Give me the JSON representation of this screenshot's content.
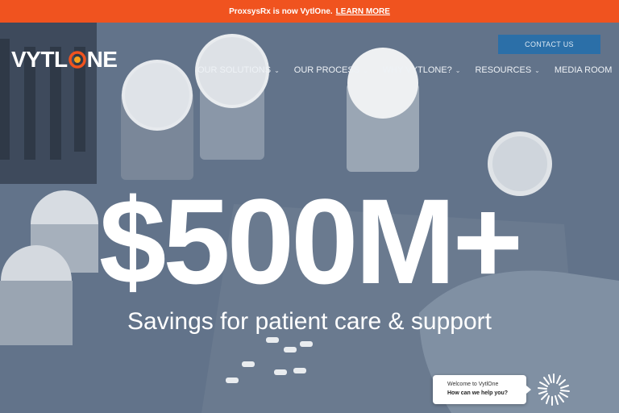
{
  "announcement": {
    "text": "ProxsysRx is now VytlOne.",
    "link": "LEARN MORE"
  },
  "logo": {
    "left": "VYTL",
    "right": "NE",
    "accent_color": "#f0531f"
  },
  "header": {
    "contact_label": "CONTACT US"
  },
  "nav": {
    "items": [
      {
        "label": "OUR SOLUTIONS",
        "dropdown": true
      },
      {
        "label": "OUR PROCESS",
        "dropdown": true
      },
      {
        "label": "WHY VYTLONE?",
        "dropdown": true
      },
      {
        "label": "RESOURCES",
        "dropdown": true
      },
      {
        "label": "MEDIA ROOM",
        "dropdown": false
      }
    ]
  },
  "hero": {
    "headline": "$500M+",
    "subheadline": "Savings for patient care & support"
  },
  "chat": {
    "line1": "Welcome to VytlOne",
    "line2": "How can we help you?",
    "icon": "chat-launcher-icon"
  },
  "colors": {
    "announce_bar": "#f0531f",
    "contact_button": "#2b6fa8",
    "hero_overlay": "#5d6e84"
  }
}
